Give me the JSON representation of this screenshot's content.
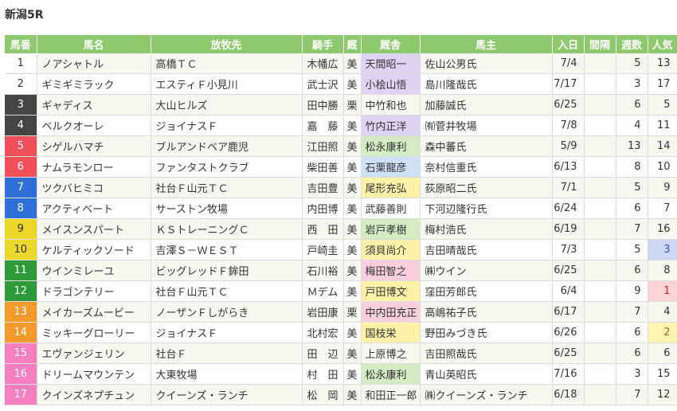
{
  "race_title": "新潟5R",
  "columns": [
    "馬番",
    "馬名",
    "放牧先",
    "騎手",
    "厩",
    "厩舎",
    "馬主",
    "入日",
    "間隔",
    "週数",
    "人気"
  ],
  "frame_colors": {
    "1": {
      "bg": "#ffffff",
      "fg": "#333333"
    },
    "2": {
      "bg": "#ffffff",
      "fg": "#333333"
    },
    "3": {
      "bg": "#444444",
      "fg": "#ffffff"
    },
    "4": {
      "bg": "#444444",
      "fg": "#ffffff"
    },
    "5": {
      "bg": "#f0505a",
      "fg": "#ffffff"
    },
    "6": {
      "bg": "#f0505a",
      "fg": "#ffffff"
    },
    "7": {
      "bg": "#2f6fd8",
      "fg": "#ffffff"
    },
    "8": {
      "bg": "#2f6fd8",
      "fg": "#ffffff"
    },
    "9": {
      "bg": "#ecd72a",
      "fg": "#333333"
    },
    "10": {
      "bg": "#ecd72a",
      "fg": "#333333"
    },
    "11": {
      "bg": "#2e9a3a",
      "fg": "#ffffff"
    },
    "12": {
      "bg": "#2e9a3a",
      "fg": "#ffffff"
    },
    "13": {
      "bg": "#f49a2c",
      "fg": "#ffffff"
    },
    "14": {
      "bg": "#f49a2c",
      "fg": "#ffffff"
    },
    "15": {
      "bg": "#f57fbf",
      "fg": "#ffffff"
    },
    "16": {
      "bg": "#f57fbf",
      "fg": "#ffffff"
    },
    "17": {
      "bg": "#f57fbf",
      "fg": "#ffffff"
    }
  },
  "rows": [
    {
      "num": "1",
      "name": "ノアシャトル",
      "farm": "高橋ＴＣ",
      "jockey": "木幡広",
      "loc": "美",
      "trainer": "天間昭一",
      "trainer_hl": "lav",
      "owner": "佐山公男氏",
      "date": "7/4",
      "interval": "",
      "weeks": "5",
      "pop": "13",
      "pop_hl": ""
    },
    {
      "num": "2",
      "name": "ギミギミラック",
      "farm": "エスティＦ小見川",
      "jockey": "武士沢",
      "loc": "美",
      "trainer": "小桧山悟",
      "trainer_hl": "lav",
      "owner": "島川隆哉氏",
      "date": "7/17",
      "interval": "",
      "weeks": "3",
      "pop": "17",
      "pop_hl": ""
    },
    {
      "num": "3",
      "name": "ギャディス",
      "farm": "大山ヒルズ",
      "jockey": "田中勝",
      "loc": "栗",
      "trainer": "中竹和也",
      "trainer_hl": "",
      "owner": "加藤誠氏",
      "date": "6/25",
      "interval": "",
      "weeks": "6",
      "pop": "5",
      "pop_hl": ""
    },
    {
      "num": "4",
      "name": "ベルクオーレ",
      "farm": "ジョイナスＦ",
      "jockey": "嘉　藤",
      "loc": "美",
      "trainer": "竹内正洋",
      "trainer_hl": "lav",
      "owner": "㈲菅井牧場",
      "date": "7/8",
      "interval": "",
      "weeks": "4",
      "pop": "11",
      "pop_hl": ""
    },
    {
      "num": "5",
      "name": "シゲルハマチ",
      "farm": "ブルアンドベア鹿児",
      "jockey": "江田照",
      "loc": "美",
      "trainer": "松永康利",
      "trainer_hl": "grn",
      "owner": "森中蕃氏",
      "date": "5/9",
      "interval": "",
      "weeks": "13",
      "pop": "14",
      "pop_hl": ""
    },
    {
      "num": "6",
      "name": "ナムラモンロー",
      "farm": "ファンタストクラブ",
      "jockey": "柴田善",
      "loc": "美",
      "trainer": "石栗龍彦",
      "trainer_hl": "blue",
      "owner": "奈村信重氏",
      "date": "6/13",
      "interval": "",
      "weeks": "8",
      "pop": "10",
      "pop_hl": ""
    },
    {
      "num": "7",
      "name": "ツクバヒミコ",
      "farm": "社台Ｆ山元ＴＣ",
      "jockey": "吉田豊",
      "loc": "美",
      "trainer": "尾形充弘",
      "trainer_hl": "yel",
      "owner": "荻原昭二氏",
      "date": "7/1",
      "interval": "",
      "weeks": "5",
      "pop": "9",
      "pop_hl": ""
    },
    {
      "num": "8",
      "name": "アクティベート",
      "farm": "サーストン牧場",
      "jockey": "内田博",
      "loc": "美",
      "trainer": "武藤善則",
      "trainer_hl": "",
      "owner": "下河辺隆行氏",
      "date": "6/24",
      "interval": "",
      "weeks": "6",
      "pop": "7",
      "pop_hl": ""
    },
    {
      "num": "9",
      "name": "メイスンスパート",
      "farm": "ＫＳトレーニングＣ",
      "jockey": "西　田",
      "loc": "美",
      "trainer": "岩戸孝樹",
      "trainer_hl": "grn",
      "owner": "梅村浩氏",
      "date": "6/19",
      "interval": "",
      "weeks": "7",
      "pop": "16",
      "pop_hl": ""
    },
    {
      "num": "10",
      "name": "ケルティックソード",
      "farm": "吉澤Ｓ－ＷＥＳＴ",
      "jockey": "戸崎圭",
      "loc": "美",
      "trainer": "須貝尚介",
      "trainer_hl": "yel",
      "owner": "吉田晴哉氏",
      "date": "7/3",
      "interval": "",
      "weeks": "5",
      "pop": "3",
      "pop_hl": "blue"
    },
    {
      "num": "11",
      "name": "ウインミレーユ",
      "farm": "ビッグレッドＦ鉾田",
      "jockey": "石川裕",
      "loc": "美",
      "trainer": "梅田智之",
      "trainer_hl": "pink",
      "owner": "㈱ウイン",
      "date": "6/25",
      "interval": "",
      "weeks": "6",
      "pop": "8",
      "pop_hl": ""
    },
    {
      "num": "12",
      "name": "ドラゴンテリー",
      "farm": "社台Ｆ山元ＴＣ",
      "jockey": "Ｍデム",
      "loc": "美",
      "trainer": "戸田博文",
      "trainer_hl": "yel",
      "owner": "窪田芳郎氏",
      "date": "6/4",
      "interval": "",
      "weeks": "9",
      "pop": "1",
      "pop_hl": "pink"
    },
    {
      "num": "13",
      "name": "メイカーズムービー",
      "farm": "ノーザンＦしがらき",
      "jockey": "岩田康",
      "loc": "栗",
      "trainer": "中内田充正",
      "trainer_hl": "pink",
      "owner": "高嶋祐子氏",
      "date": "6/17",
      "interval": "",
      "weeks": "7",
      "pop": "4",
      "pop_hl": ""
    },
    {
      "num": "14",
      "name": "ミッキーグローリー",
      "farm": "ジョイナスＦ",
      "jockey": "北村宏",
      "loc": "美",
      "trainer": "国枝栄",
      "trainer_hl": "yel",
      "owner": "野田みづき氏",
      "date": "6/26",
      "interval": "",
      "weeks": "6",
      "pop": "2",
      "pop_hl": "yel"
    },
    {
      "num": "15",
      "name": "エヴァンジェリン",
      "farm": "社台Ｆ",
      "jockey": "田　辺",
      "loc": "美",
      "trainer": "上原博之",
      "trainer_hl": "",
      "owner": "吉田照哉氏",
      "date": "6/25",
      "interval": "",
      "weeks": "6",
      "pop": "6",
      "pop_hl": ""
    },
    {
      "num": "16",
      "name": "ドリームマウンテン",
      "farm": "大東牧場",
      "jockey": "村　田",
      "loc": "美",
      "trainer": "松永康利",
      "trainer_hl": "grn",
      "owner": "青山英昭氏",
      "date": "7/16",
      "interval": "",
      "weeks": "3",
      "pop": "15",
      "pop_hl": ""
    },
    {
      "num": "17",
      "name": "クインズネプチュン",
      "farm": "クイーンズ・ランチ",
      "jockey": "松　岡",
      "loc": "美",
      "trainer": "和田正一郎",
      "trainer_hl": "",
      "owner": "㈱クイーンズ・ランチ",
      "date": "6/18",
      "interval": "",
      "weeks": "7",
      "pop": "12",
      "pop_hl": ""
    }
  ]
}
